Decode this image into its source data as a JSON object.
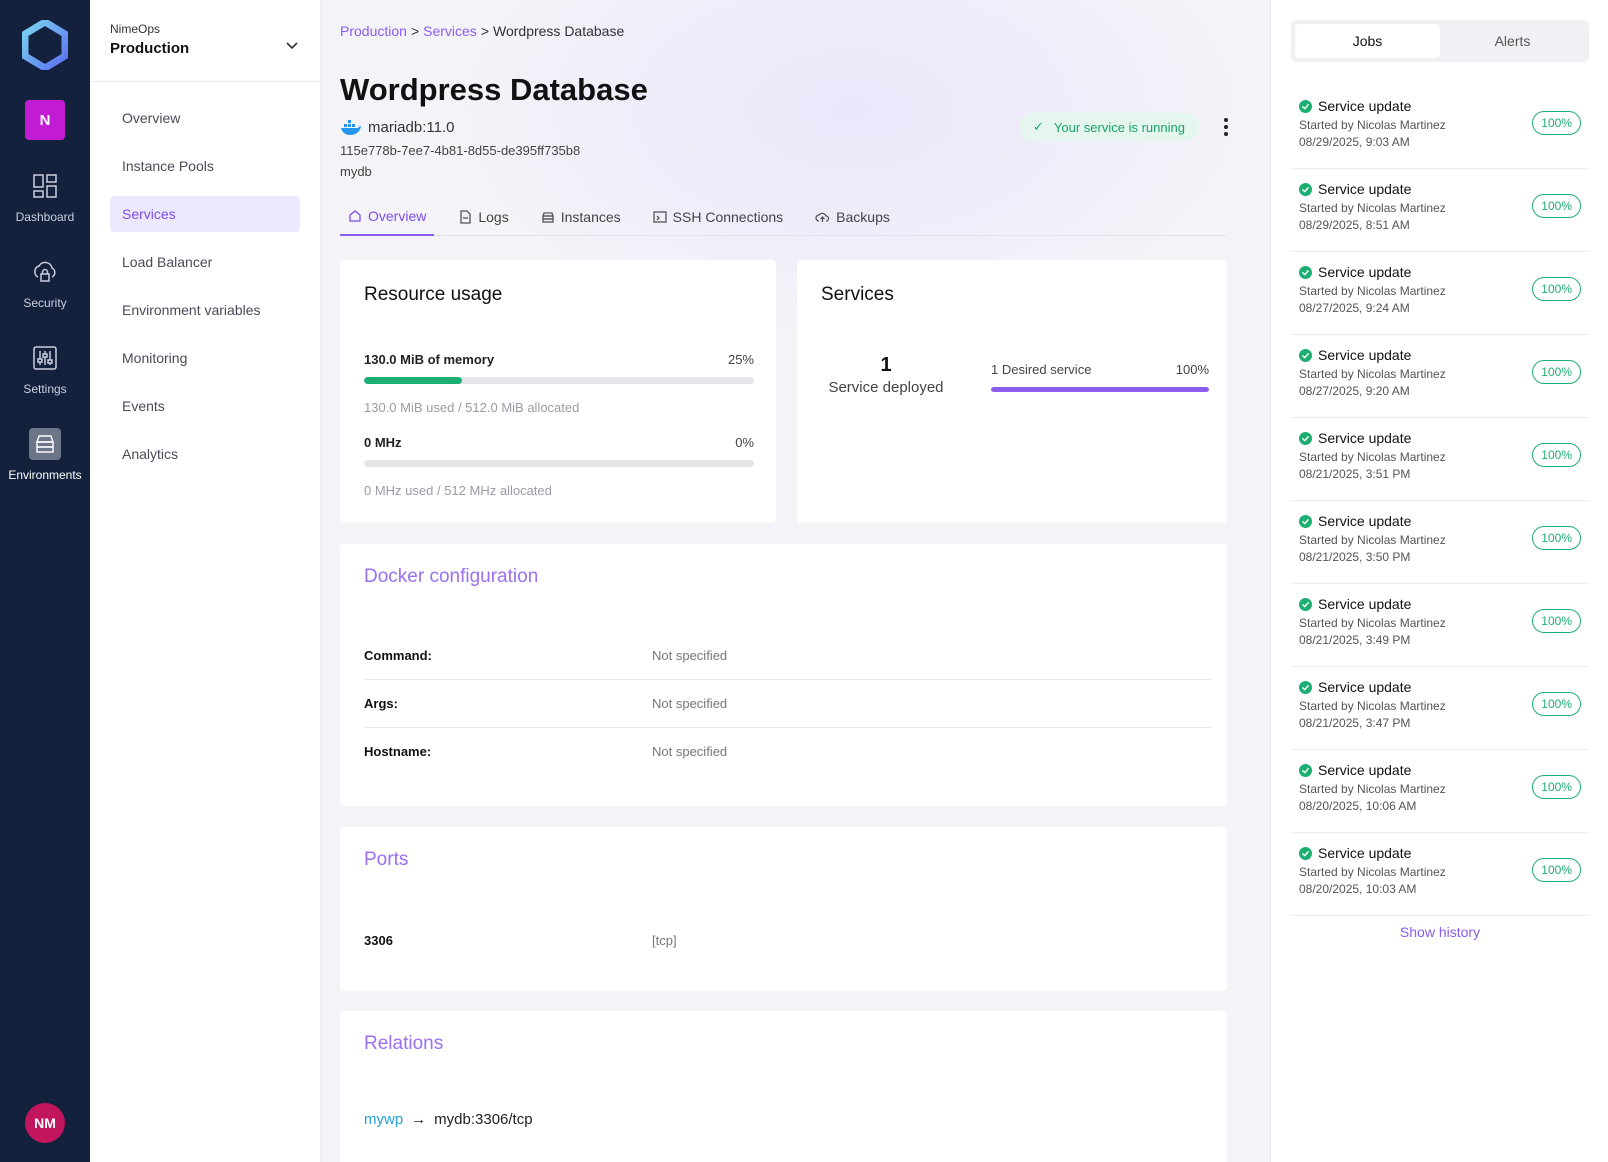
{
  "rail": {
    "org_initial": "N",
    "items": [
      {
        "label": "Dashboard",
        "icon": "dashboard-icon"
      },
      {
        "label": "Security",
        "icon": "cloud-lock-icon"
      },
      {
        "label": "Settings",
        "icon": "sliders-icon"
      },
      {
        "label": "Environments",
        "icon": "server-stack-icon"
      }
    ],
    "user_initials": "NM",
    "colors": {
      "bg": "#14213d",
      "org_badge": "#c21bd4",
      "avatar": "#c1155d"
    }
  },
  "env_switcher": {
    "org": "NimeOps",
    "environment": "Production"
  },
  "subnav": {
    "items": [
      {
        "label": "Overview"
      },
      {
        "label": "Instance Pools"
      },
      {
        "label": "Services"
      },
      {
        "label": "Load Balancer"
      },
      {
        "label": "Environment variables"
      },
      {
        "label": "Monitoring"
      },
      {
        "label": "Events"
      },
      {
        "label": "Analytics"
      }
    ],
    "active": "Services"
  },
  "breadcrumb": {
    "items": [
      "Production",
      "Services",
      "Wordpress Database"
    ],
    "separator": ">"
  },
  "service": {
    "title": "Wordpress Database",
    "image": "mariadb:11.0",
    "id": "115e778b-7ee7-4b81-8d55-de395ff735b8",
    "alias": "mydb",
    "status": "Your service is running"
  },
  "tabs": [
    {
      "label": "Overview",
      "icon": "home-icon"
    },
    {
      "label": "Logs",
      "icon": "file-icon"
    },
    {
      "label": "Instances",
      "icon": "server-icon"
    },
    {
      "label": "SSH Connections",
      "icon": "terminal-icon"
    },
    {
      "label": "Backups",
      "icon": "cloud-upload-icon"
    }
  ],
  "resource_usage": {
    "title": "Resource usage",
    "memory": {
      "label": "130.0 MiB of memory",
      "percent_label": "25%",
      "fraction": 0.25,
      "detail": "130.0 MiB used / 512.0 MiB allocated"
    },
    "cpu": {
      "label": "0 MHz",
      "percent_label": "0%",
      "fraction": 0,
      "detail": "0 MHz used / 512 MHz allocated"
    }
  },
  "services_card": {
    "title": "Services",
    "deployed_count": "1",
    "deployed_label": "Service deployed",
    "desired_label": "1 Desired service",
    "desired_percent": "100%",
    "desired_fraction": 1
  },
  "docker": {
    "title": "Docker configuration",
    "rows": [
      {
        "key": "Command:",
        "value": "Not specified"
      },
      {
        "key": "Args:",
        "value": "Not specified"
      },
      {
        "key": "Hostname:",
        "value": "Not specified"
      }
    ]
  },
  "ports": {
    "title": "Ports",
    "rows": [
      {
        "port": "3306",
        "protocol": "[tcp]"
      }
    ]
  },
  "relations": {
    "title": "Relations",
    "rows": [
      {
        "from": "mywp",
        "to": "mydb:3306/tcp"
      }
    ]
  },
  "right_panel": {
    "tabs": [
      "Jobs",
      "Alerts"
    ],
    "active_tab": "Jobs",
    "jobs": [
      {
        "title": "Service update",
        "by": "Started by Nicolas Martinez",
        "date": "08/29/2025, 9:03 AM",
        "progress": "100%"
      },
      {
        "title": "Service update",
        "by": "Started by Nicolas Martinez",
        "date": "08/29/2025, 8:51 AM",
        "progress": "100%"
      },
      {
        "title": "Service update",
        "by": "Started by Nicolas Martinez",
        "date": "08/27/2025, 9:24 AM",
        "progress": "100%"
      },
      {
        "title": "Service update",
        "by": "Started by Nicolas Martinez",
        "date": "08/27/2025, 9:20 AM",
        "progress": "100%"
      },
      {
        "title": "Service update",
        "by": "Started by Nicolas Martinez",
        "date": "08/21/2025, 3:51 PM",
        "progress": "100%"
      },
      {
        "title": "Service update",
        "by": "Started by Nicolas Martinez",
        "date": "08/21/2025, 3:50 PM",
        "progress": "100%"
      },
      {
        "title": "Service update",
        "by": "Started by Nicolas Martinez",
        "date": "08/21/2025, 3:49 PM",
        "progress": "100%"
      },
      {
        "title": "Service update",
        "by": "Started by Nicolas Martinez",
        "date": "08/21/2025, 3:47 PM",
        "progress": "100%"
      },
      {
        "title": "Service update",
        "by": "Started by Nicolas Martinez",
        "date": "08/20/2025, 10:06 AM",
        "progress": "100%"
      },
      {
        "title": "Service update",
        "by": "Started by Nicolas Martinez",
        "date": "08/20/2025, 10:03 AM",
        "progress": "100%"
      }
    ],
    "show_history": "Show history"
  },
  "colors": {
    "accent": "#8a5cf0",
    "success": "#1dae73",
    "status_bg": "#e4f6ee"
  }
}
